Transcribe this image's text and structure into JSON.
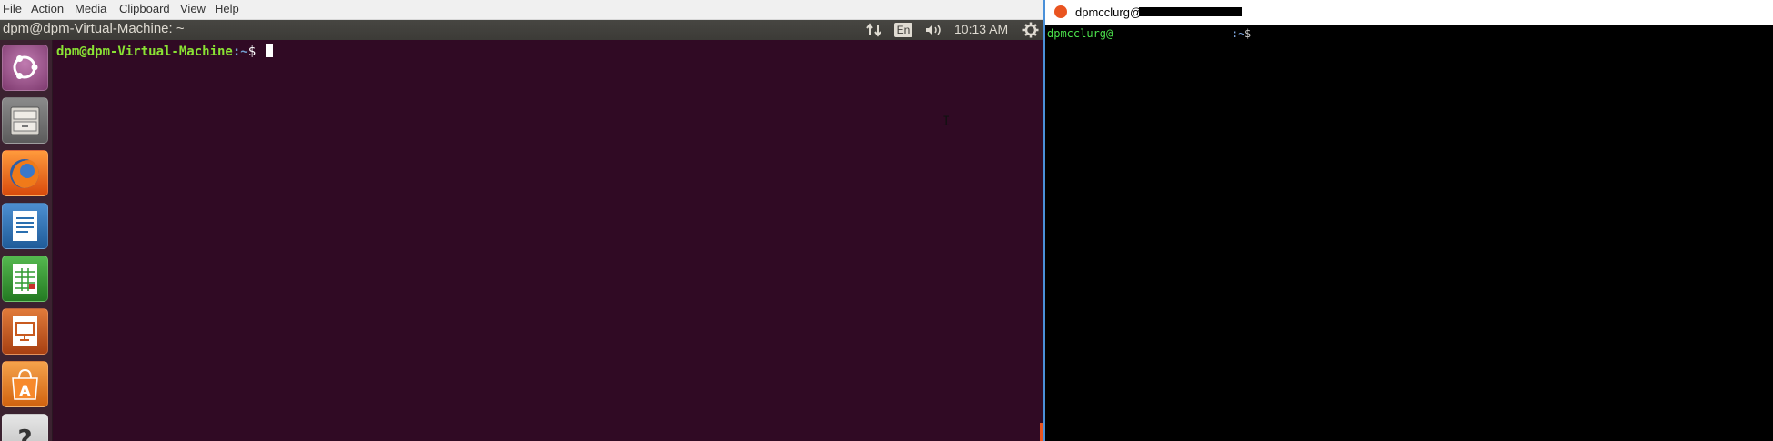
{
  "vm_menu": {
    "items": [
      {
        "label": "File"
      },
      {
        "label": "Action"
      },
      {
        "label": "Media"
      },
      {
        "label": "Clipboard"
      },
      {
        "label": "View"
      },
      {
        "label": "Help"
      }
    ]
  },
  "ubuntu_panel": {
    "title": "dpm@dpm-Virtual-Machine: ~",
    "language": "En",
    "clock": "10:13 AM",
    "icons": [
      "network-arrows-icon",
      "volume-icon",
      "settings-gear-icon"
    ]
  },
  "launcher": {
    "items": [
      {
        "name": "dash-home",
        "icon": "ubuntu-logo-icon",
        "color": "#9f4d8a"
      },
      {
        "name": "files",
        "icon": "file-cabinet-icon",
        "color": "#7a7a7a"
      },
      {
        "name": "firefox",
        "icon": "firefox-icon",
        "color": "#e66000"
      },
      {
        "name": "writer",
        "icon": "libreoffice-writer-icon",
        "color": "#2a6fb0"
      },
      {
        "name": "calc",
        "icon": "libreoffice-calc-icon",
        "color": "#2f9a2f"
      },
      {
        "name": "impress",
        "icon": "libreoffice-impress-icon",
        "color": "#c85a1f"
      },
      {
        "name": "software-center",
        "icon": "software-center-icon",
        "color": "#e8761c"
      },
      {
        "name": "help",
        "icon": "help-icon",
        "color": "#dddddd"
      }
    ]
  },
  "terminal": {
    "user_host": "dpm@dpm-Virtual-Machine",
    "path": ":~",
    "prompt": "$ ",
    "bg": "#300a24"
  },
  "ssh": {
    "title_prefix": "dpmcclurg@",
    "prompt_user": "dpmcclurg@",
    "prompt_path": ":~",
    "prompt_symbol": "$"
  }
}
